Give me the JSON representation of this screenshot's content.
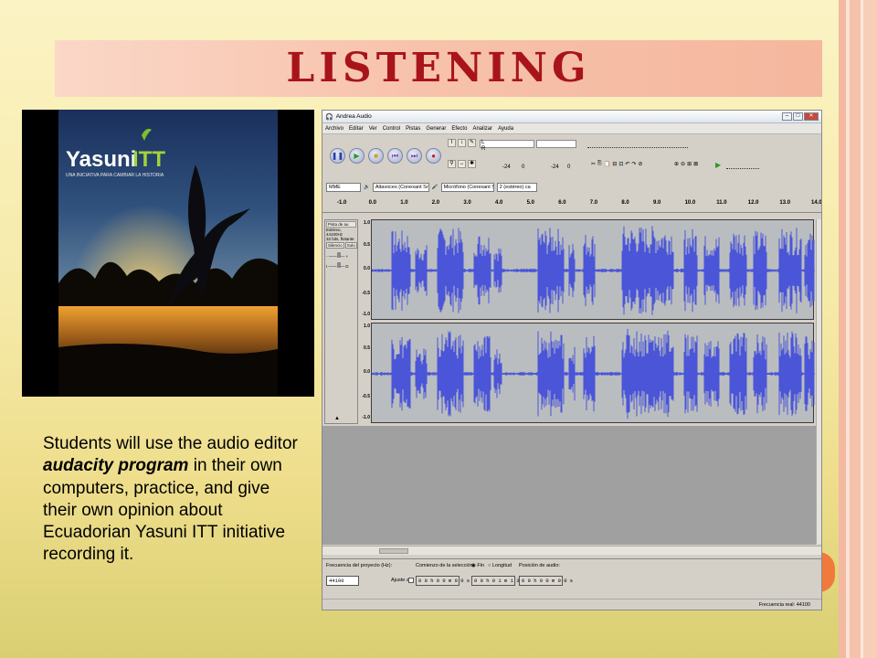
{
  "slide": {
    "title": "LISTENING",
    "caption_pre": "Students will use the audio editor ",
    "caption_emph": "audacity program",
    "caption_post": " in their own computers, practice, and give their own opinion about Ecuadorian Yasuni ITT initiative recording it.",
    "accent_color": "#a8141a",
    "band_color": "#f7c1aa"
  },
  "photo": {
    "logo_main": "Yasuni",
    "logo_itt": "ITT",
    "tagline": "UNA INICIATIVA PARA CAMBIAR LA HISTORIA"
  },
  "audacity": {
    "window_title": "Andrea Audio",
    "menu": [
      "Archivo",
      "Editar",
      "Ver",
      "Control",
      "Pistas",
      "Generar",
      "Efecto",
      "Analizar",
      "Ayuda"
    ],
    "meter_left": "L",
    "meter_right": "R",
    "meter_db1": "-24",
    "meter_zero1": "0",
    "meter_db2": "-24",
    "meter_zero2": "0",
    "host": "MME",
    "output_device": "Altavoces (Conexant Sr",
    "input_device": "Micrófono (Conexant S",
    "channels": "2 (estéreo) ca",
    "ruler_ticks": [
      "-1.0",
      "0.0",
      "1.0",
      "2.0",
      "3.0",
      "4.0",
      "5.0",
      "6.0",
      "7.0",
      "8.0",
      "9.0",
      "10.0",
      "11.0",
      "12.0",
      "13.0",
      "14.0"
    ],
    "track": {
      "name": "Pista de au",
      "info1": "Estéreo, 44100Hz",
      "info2": "32 bits, flotante",
      "mute": "Silencio",
      "solo": "Solo",
      "gain_minus": "-",
      "gain_plus": "+",
      "pan_left": "I",
      "pan_right": "D"
    },
    "amp_scale": [
      "1.0",
      "0.5",
      "0.0",
      "-0.5",
      "-1.0"
    ],
    "wave_color": "#4a55d8",
    "selection_bar": {
      "rate_label": "Frecuencia del proyecto (Hz):",
      "rate_value": "44100",
      "sel_start_label": "Comienzo de la selección:",
      "end_label": "Fin",
      "length_label": "Longitud",
      "snap_label": "Ajuste a",
      "start_time": "0 0 h 0 0 m 0 0 s",
      "end_time": "0 0 h 0 1 m 1 3 s",
      "position_label": "Posición de audio:",
      "position_time": "0 0 h 0 0 m 0 0 s"
    },
    "status": "Frecuencia real: 44100"
  }
}
